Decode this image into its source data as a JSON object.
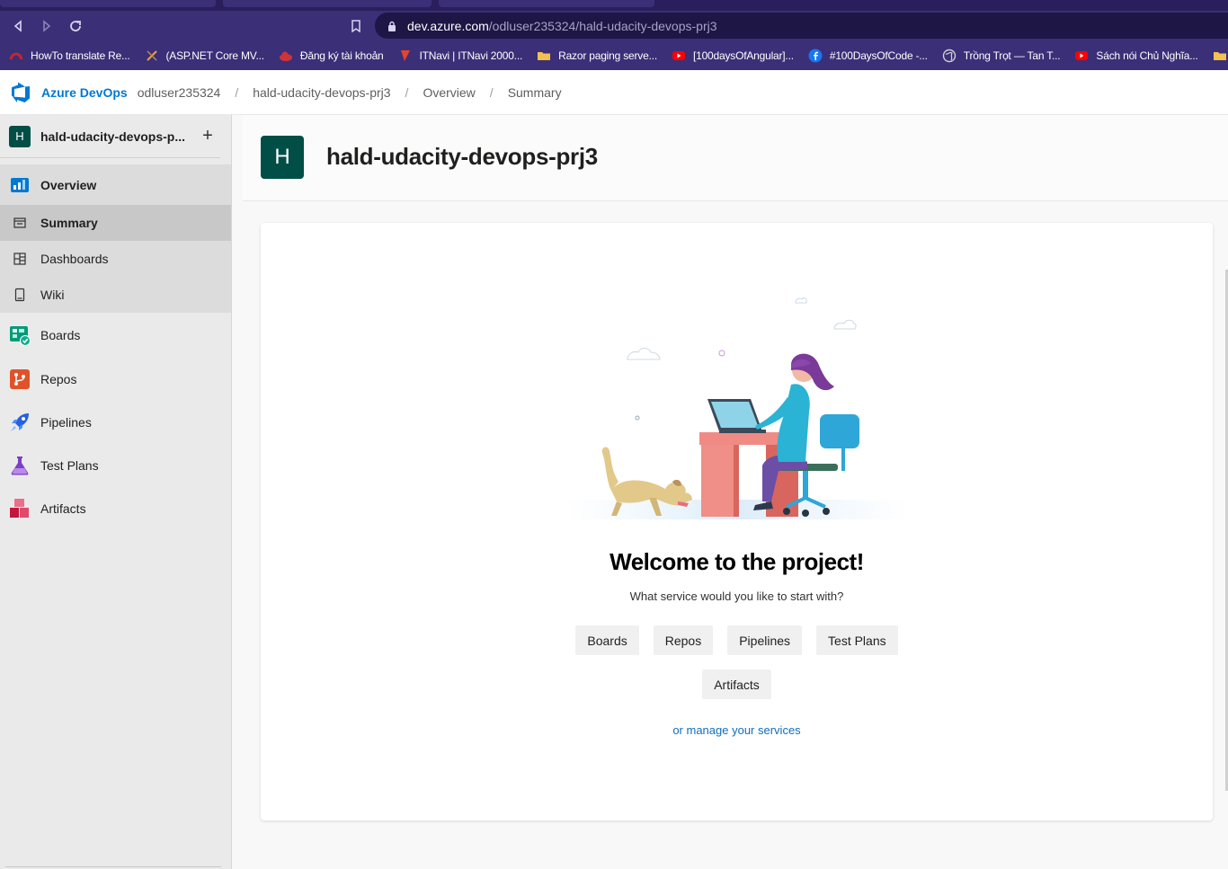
{
  "browser": {
    "url_host": "dev.azure.com",
    "url_path": "/odluser235324/hald-udacity-devops-prj3",
    "bookmarks": [
      {
        "label": "HowTo translate Re...",
        "icon": "red-swirl-icon",
        "color": "#c4262e"
      },
      {
        "label": "(ASP.NET Core MV...",
        "icon": "tools-icon",
        "color": "#e8a33c"
      },
      {
        "label": "Đăng ký tài khoản",
        "icon": "cloud-red-icon",
        "color": "#d13438"
      },
      {
        "label": "ITNavi | ITNavi 2000...",
        "icon": "flag-red-icon",
        "color": "#e3442c"
      },
      {
        "label": "Razor paging serve...",
        "icon": "folder-icon",
        "color": "#f2c14e"
      },
      {
        "label": "[100daysOfAngular]...",
        "icon": "youtube-icon",
        "color": "#ff0000"
      },
      {
        "label": "#100DaysOfCode -...",
        "icon": "facebook-icon",
        "color": "#1877f2"
      },
      {
        "label": "Trồng Trọt — Tan T...",
        "icon": "globe-icon",
        "color": "#cfcfcf"
      },
      {
        "label": "Sách nói Chủ Nghĩa...",
        "icon": "youtube-icon",
        "color": "#ff0000"
      }
    ]
  },
  "header": {
    "brand": "Azure DevOps",
    "breadcrumbs": [
      "odluser235324",
      "hald-udacity-devops-prj3",
      "Overview",
      "Summary"
    ],
    "separator": "/"
  },
  "sidebar": {
    "project_initial": "H",
    "project_name": "hald-udacity-devops-p...",
    "plus": "+",
    "items": [
      {
        "label": "Overview",
        "icon": "overview-icon"
      },
      {
        "label": "Summary",
        "icon": "summary-icon"
      },
      {
        "label": "Dashboards",
        "icon": "dashboards-icon"
      },
      {
        "label": "Wiki",
        "icon": "wiki-icon"
      },
      {
        "label": "Boards",
        "icon": "boards-icon"
      },
      {
        "label": "Repos",
        "icon": "repos-icon"
      },
      {
        "label": "Pipelines",
        "icon": "pipelines-icon"
      },
      {
        "label": "Test Plans",
        "icon": "test-plans-icon"
      },
      {
        "label": "Artifacts",
        "icon": "artifacts-icon"
      }
    ]
  },
  "page": {
    "initial": "H",
    "title": "hald-udacity-devops-prj3"
  },
  "welcome": {
    "title": "Welcome to the project!",
    "subtitle": "What service would you like to start with?",
    "services": [
      "Boards",
      "Repos",
      "Pipelines",
      "Test Plans",
      "Artifacts"
    ],
    "manage_link": "or manage your services"
  },
  "colors": {
    "brand": "#0078d4",
    "project_avatar": "#004e46",
    "browser_chrome": "#3b2f78"
  }
}
